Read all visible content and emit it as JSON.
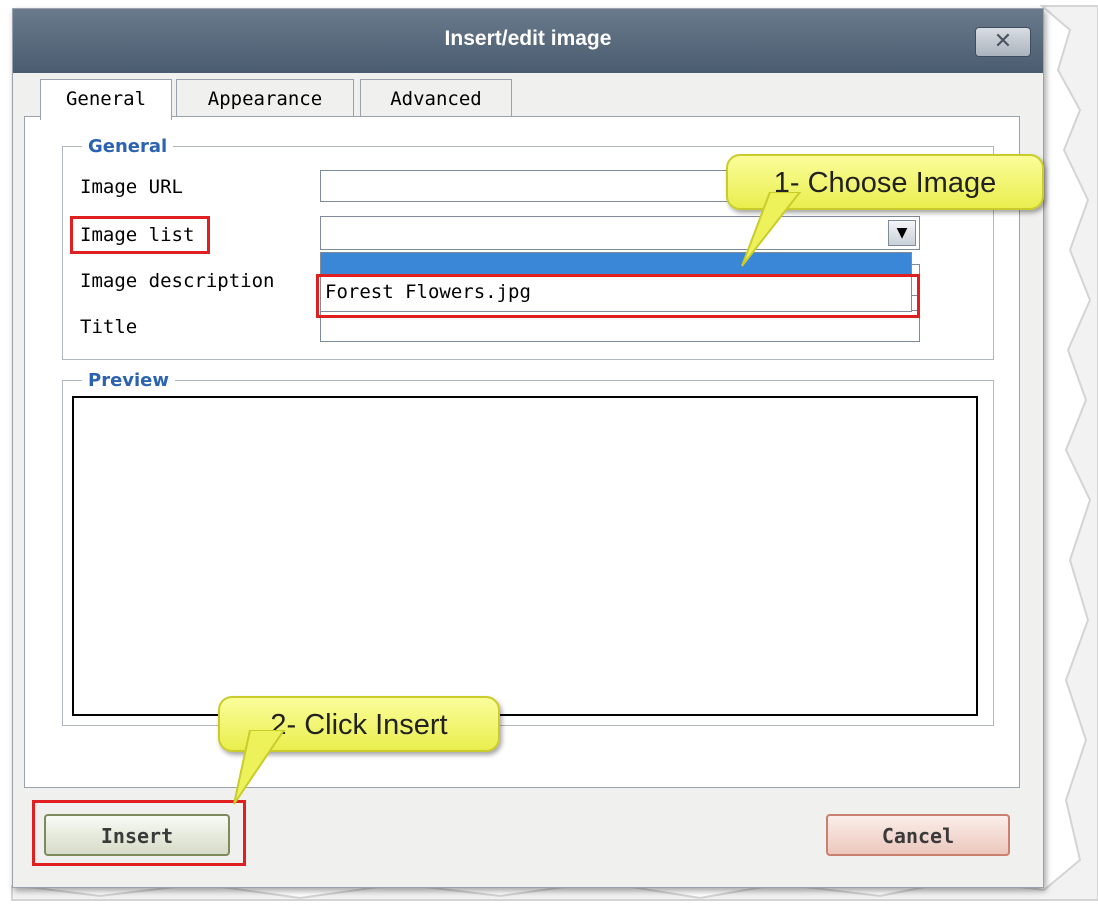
{
  "dialog": {
    "title": "Insert/edit image",
    "close_glyph": "✕"
  },
  "tabs": [
    {
      "label": "General",
      "active": true
    },
    {
      "label": "Appearance",
      "active": false
    },
    {
      "label": "Advanced",
      "active": false
    }
  ],
  "general_section": {
    "legend": "General",
    "fields": {
      "image_url": {
        "label": "Image URL",
        "value": ""
      },
      "image_list": {
        "label": "Image list",
        "selected": ""
      },
      "image_description": {
        "label": "Image description",
        "value": ""
      },
      "title": {
        "label": "Title",
        "value": ""
      }
    },
    "dropdown_options": [
      "",
      "Forest Flowers.jpg"
    ]
  },
  "preview_section": {
    "legend": "Preview"
  },
  "buttons": {
    "insert": "Insert",
    "cancel": "Cancel"
  },
  "callouts": {
    "choose_image": "1- Choose Image",
    "click_insert": "2- Click Insert"
  },
  "colors": {
    "title_bar": "#4a5c70",
    "legend_text": "#2b63b0",
    "dropdown_highlight": "#3a87d8",
    "annotation_red": "#e02020",
    "callout_yellow": "#f2f56e"
  }
}
